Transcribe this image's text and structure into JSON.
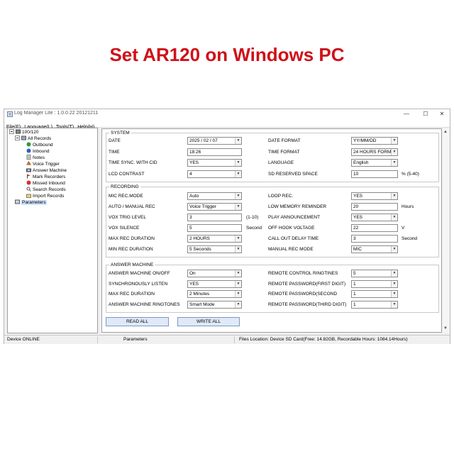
{
  "headline": "Set AR120 on Windows PC",
  "window": {
    "title": "Log Manager Lite : 1.0.0.22 20121211",
    "controls": [
      "—",
      "☐",
      "✕"
    ]
  },
  "menu": [
    "File(F)",
    "Language(L)",
    "Tools(T)",
    "Help(H)"
  ],
  "tree": {
    "root": "100/120",
    "all_records": "All Records",
    "items": [
      "Outbound",
      "Inbound",
      "Notes",
      "Voice Trigger",
      "Answer Machine",
      "Mark Recorders",
      "Missed Inbound",
      "Search Records",
      "Import Records"
    ],
    "parameters": "Parameters"
  },
  "system": {
    "title": "SYSTEM",
    "rows": [
      {
        "label": "DATE",
        "value": "2025 / 02 / 07",
        "dropdown": true,
        "unit": "",
        "label2": "DATE FORMAT",
        "value2": "YY/MM/DD",
        "dropdown2": true,
        "unit2": ""
      },
      {
        "label": "TIME",
        "value": "18:26",
        "dropdown": false,
        "unit": "",
        "label2": "TIME FORMAT",
        "value2": "24 HOURS FORM",
        "dropdown2": true,
        "unit2": ""
      },
      {
        "label": "TIME SYNC. WITH CID",
        "value": "YES",
        "dropdown": true,
        "unit": "",
        "label2": "LANGUAGE",
        "value2": "English",
        "dropdown2": true,
        "unit2": ""
      },
      {
        "label": "LCD CONTRAST",
        "value": "4",
        "dropdown": true,
        "unit": "",
        "label2": "SD RESERVED SPACE",
        "value2": "10",
        "dropdown2": false,
        "unit2": "% (5-40)"
      }
    ]
  },
  "recording": {
    "title": "RECORDING",
    "rows": [
      {
        "label": "MIC REC.MODE",
        "value": "Auto",
        "dropdown": true,
        "unit": "",
        "label2": "LOOP REC.",
        "value2": "YES",
        "dropdown2": true,
        "unit2": ""
      },
      {
        "label": "AUTO / MANUAL REC",
        "value": "Voice Trigger",
        "dropdown": true,
        "unit": "",
        "label2": "LOW MEMORY REMINDER",
        "value2": "20",
        "dropdown2": false,
        "unit2": "Hours"
      },
      {
        "label": "VOX TRIG LEVEL",
        "value": "3",
        "dropdown": false,
        "unit": "(1-10)",
        "label2": "PLAY ANNOUNCEMENT",
        "value2": "YES",
        "dropdown2": true,
        "unit2": ""
      },
      {
        "label": "VOX SILENCE",
        "value": "5",
        "dropdown": false,
        "unit": "Second",
        "label2": "OFF HOOK VOLTAGE",
        "value2": "22",
        "dropdown2": false,
        "unit2": "V"
      },
      {
        "label": "MAX REC DURATION",
        "value": "2 HOURS",
        "dropdown": true,
        "unit": "",
        "label2": "CALL OUT DELAY TIME",
        "value2": "3",
        "dropdown2": false,
        "unit2": "Second"
      },
      {
        "label": "MIN REC DURATION",
        "value": "5 Seconds",
        "dropdown": true,
        "unit": "",
        "label2": "MANUAL REC MODE",
        "value2": "MIC",
        "dropdown2": true,
        "unit2": ""
      }
    ]
  },
  "answer_machine": {
    "title": "ANSWER MACHINE",
    "rows": [
      {
        "label": "ANSWER MACHINE ON/OFF",
        "value": "On",
        "dropdown": true,
        "unit": "",
        "label2": "REMOTE CONTROL RINGTINES",
        "value2": "5",
        "dropdown2": true,
        "unit2": ""
      },
      {
        "label": "SYNCHRONOUSLY LISTEN",
        "value": "YES",
        "dropdown": true,
        "unit": "",
        "label2": "REMOTE PASSWORD(FIRST DIGIT)",
        "value2": "1",
        "dropdown2": true,
        "unit2": ""
      },
      {
        "label": "MAX REC DURATION",
        "value": "2 Minutes",
        "dropdown": true,
        "unit": "",
        "label2": "REMOTE PASSWORD(SECOND",
        "value2": "1",
        "dropdown2": true,
        "unit2": ""
      },
      {
        "label": "ANSWER MACHINE RINGTONES",
        "value": "Smart Mode",
        "dropdown": true,
        "unit": "",
        "label2": "REMOTE PASSWORD(THIRD DIGIT)",
        "value2": "1",
        "dropdown2": true,
        "unit2": ""
      }
    ]
  },
  "buttons": {
    "read_all": "READ ALL",
    "write_all": "WRITE ALL"
  },
  "status": {
    "device": "Device ONLINE",
    "page": "Parameters",
    "files": "Files Location: Device SD Card(Free: 14.82GB, Recordable Hours: 1084.14Hours)"
  },
  "colors": {
    "headline": "#d01018",
    "selection": "#cfe3ff",
    "button": "#dfe9f7"
  }
}
